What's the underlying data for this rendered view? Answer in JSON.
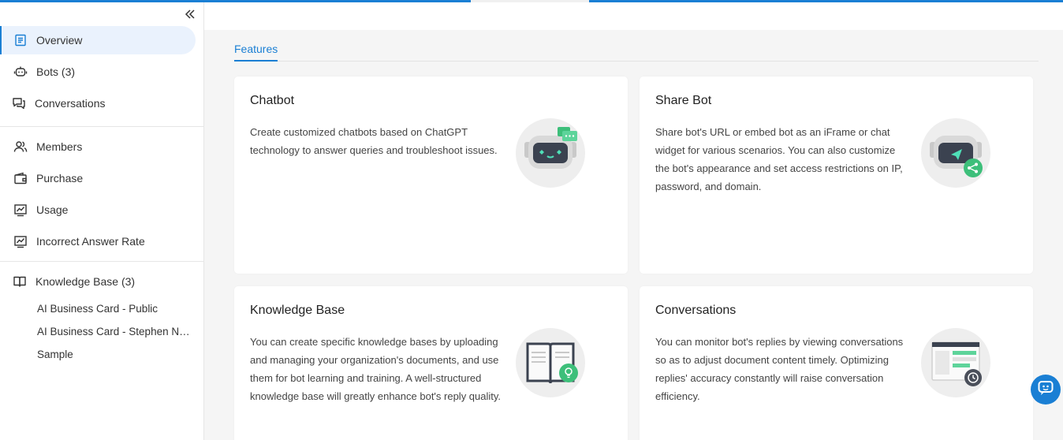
{
  "sidebar": {
    "nav_top": [
      {
        "label": "Overview",
        "icon": "document-icon",
        "active": true
      },
      {
        "label": "Bots (3)",
        "icon": "robot-icon"
      },
      {
        "label": "Conversations",
        "icon": "chat-bubbles-icon"
      }
    ],
    "nav_mid": [
      {
        "label": "Members",
        "icon": "users-icon"
      },
      {
        "label": "Purchase",
        "icon": "wallet-icon"
      },
      {
        "label": "Usage",
        "icon": "chart-icon"
      },
      {
        "label": "Incorrect Answer Rate",
        "icon": "chart-icon"
      }
    ],
    "knowledge_base": {
      "label": "Knowledge Base (3)",
      "icon": "book-icon",
      "items": [
        "AI Business Card - Public",
        "AI Business Card - Stephen Ng...",
        "Sample"
      ]
    }
  },
  "main": {
    "tabs": [
      {
        "label": "Features"
      }
    ],
    "cards": [
      {
        "title": "Chatbot",
        "text": "Create customized chatbots based on ChatGPT technology to answer queries and troubleshoot issues.",
        "illustration": "robot-chat-illustration"
      },
      {
        "title": "Share Bot",
        "text": "Share bot's URL or embed bot as an iFrame or chat widget for various scenarios. You can also customize the bot's appearance and set access restrictions on IP, password, and domain.",
        "illustration": "robot-share-illustration"
      },
      {
        "title": "Knowledge Base",
        "text": "You can create specific knowledge bases by uploading and managing your organization's documents, and use them for bot learning and training. A well-structured knowledge base will greatly enhance bot's reply quality.",
        "illustration": "book-bulb-illustration"
      },
      {
        "title": "Conversations",
        "text": "You can monitor bot's replies by viewing conversations so as to adjust document content timely. Optimizing replies' accuracy constantly will raise conversation efficiency.",
        "illustration": "history-screen-illustration"
      }
    ]
  },
  "colors": {
    "accent": "#1a7fd4",
    "active_bg": "#eaf2fd",
    "green": "#3dbf7a"
  },
  "chat_widget": {
    "icon": "chat-widget-icon"
  }
}
